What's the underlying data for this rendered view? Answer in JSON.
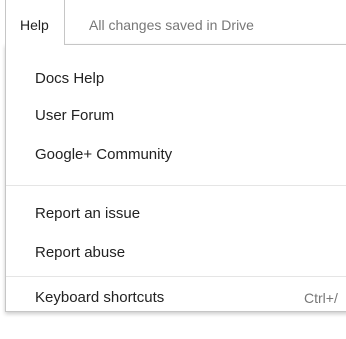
{
  "menubar": {
    "help_label": "Help",
    "save_status": "All changes saved in Drive"
  },
  "help_menu": {
    "items": [
      {
        "label": "Docs Help"
      },
      {
        "label": "User Forum"
      },
      {
        "label": "Google+ Community"
      },
      {
        "label": "Report an issue"
      },
      {
        "label": "Report abuse"
      },
      {
        "label": "Keyboard shortcuts",
        "shortcut": "Ctrl+/"
      }
    ]
  }
}
